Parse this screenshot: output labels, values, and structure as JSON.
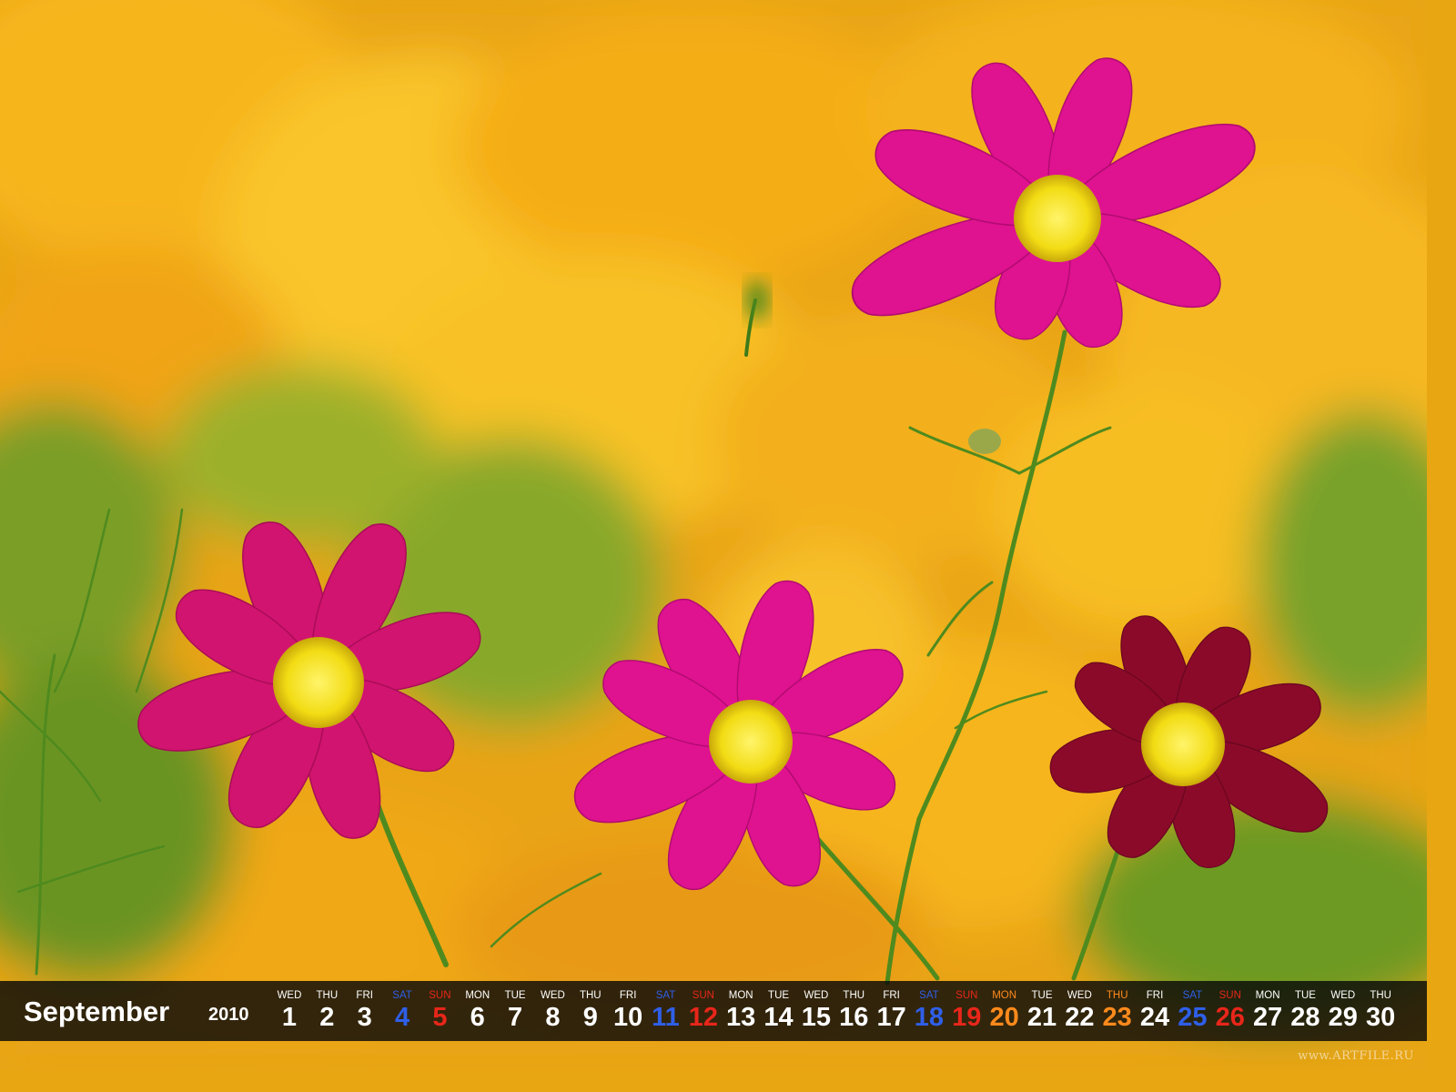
{
  "scene": {
    "subject": "pink-and-crimson-cosmos-flowers",
    "background": "blurred-orange-yellow-flower-field",
    "colors": {
      "background_orange": "#f2a514",
      "background_yellow": "#f6c62a",
      "foliage_green": "#6f9a24",
      "petal_magenta": "#d4147d",
      "petal_pink": "#e0108f",
      "petal_crimson": "#8e0b2a",
      "flower_center": "#f5e020",
      "stem_green": "#3f7a1c"
    }
  },
  "calendar": {
    "month": "September",
    "year": "2010",
    "colors": {
      "weekday": "#ffffff",
      "saturday": "#2f5fe8",
      "sunday": "#e8261a",
      "holiday": "#ff8a1c"
    },
    "days": [
      {
        "dow": "WED",
        "date": "1",
        "type": "weekday"
      },
      {
        "dow": "THU",
        "date": "2",
        "type": "weekday"
      },
      {
        "dow": "FRI",
        "date": "3",
        "type": "weekday"
      },
      {
        "dow": "SAT",
        "date": "4",
        "type": "saturday"
      },
      {
        "dow": "SUN",
        "date": "5",
        "type": "sunday"
      },
      {
        "dow": "MON",
        "date": "6",
        "type": "weekday"
      },
      {
        "dow": "TUE",
        "date": "7",
        "type": "weekday"
      },
      {
        "dow": "WED",
        "date": "8",
        "type": "weekday"
      },
      {
        "dow": "THU",
        "date": "9",
        "type": "weekday"
      },
      {
        "dow": "FRI",
        "date": "10",
        "type": "weekday"
      },
      {
        "dow": "SAT",
        "date": "11",
        "type": "saturday"
      },
      {
        "dow": "SUN",
        "date": "12",
        "type": "sunday"
      },
      {
        "dow": "MON",
        "date": "13",
        "type": "weekday"
      },
      {
        "dow": "TUE",
        "date": "14",
        "type": "weekday"
      },
      {
        "dow": "WED",
        "date": "15",
        "type": "weekday"
      },
      {
        "dow": "THU",
        "date": "16",
        "type": "weekday"
      },
      {
        "dow": "FRI",
        "date": "17",
        "type": "weekday"
      },
      {
        "dow": "SAT",
        "date": "18",
        "type": "saturday"
      },
      {
        "dow": "SUN",
        "date": "19",
        "type": "sunday"
      },
      {
        "dow": "MON",
        "date": "20",
        "type": "holiday"
      },
      {
        "dow": "TUE",
        "date": "21",
        "type": "weekday"
      },
      {
        "dow": "WED",
        "date": "22",
        "type": "weekday"
      },
      {
        "dow": "THU",
        "date": "23",
        "type": "holiday"
      },
      {
        "dow": "FRI",
        "date": "24",
        "type": "weekday"
      },
      {
        "dow": "SAT",
        "date": "25",
        "type": "saturday"
      },
      {
        "dow": "SUN",
        "date": "26",
        "type": "sunday"
      },
      {
        "dow": "MON",
        "date": "27",
        "type": "weekday"
      },
      {
        "dow": "TUE",
        "date": "28",
        "type": "weekday"
      },
      {
        "dow": "WED",
        "date": "29",
        "type": "weekday"
      },
      {
        "dow": "THU",
        "date": "30",
        "type": "weekday"
      }
    ]
  },
  "watermark": "www.ARTFILE.RU"
}
